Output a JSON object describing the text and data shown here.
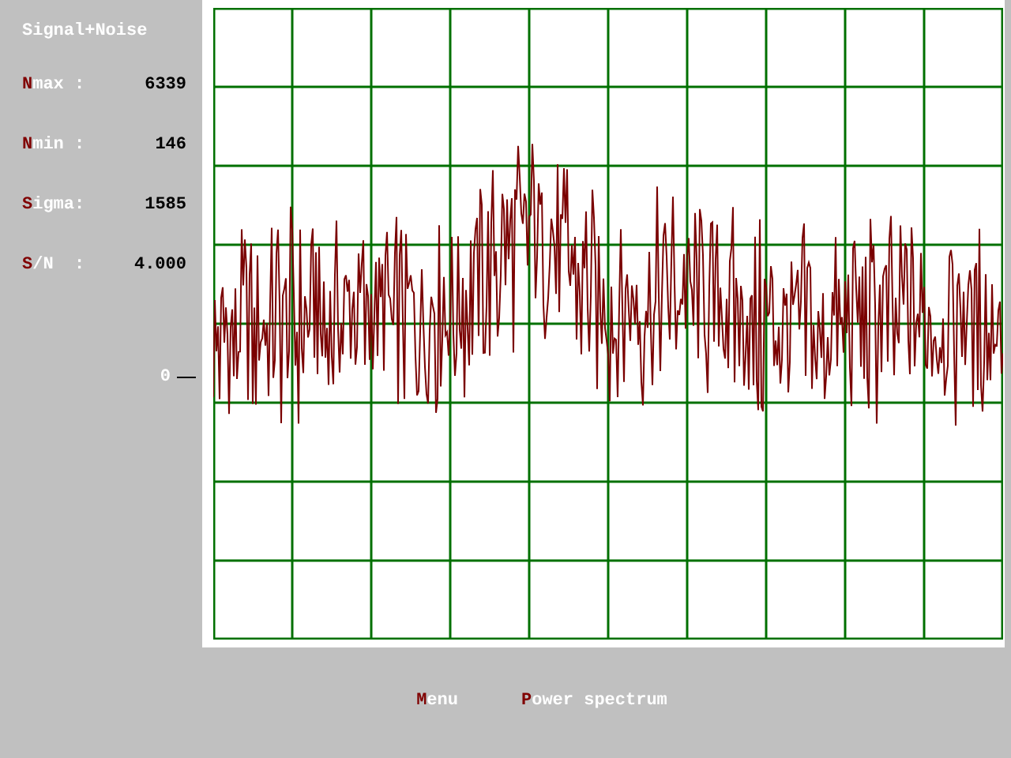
{
  "title": "Signal+Noise",
  "stats": [
    {
      "label": "Nmax :",
      "value": "6339"
    },
    {
      "label": "Nmin :",
      "value": "146"
    },
    {
      "label": "Sigma:",
      "value": "1585"
    },
    {
      "label": "S/N  :",
      "value": "4.000"
    }
  ],
  "plot": {
    "zero_label": "0"
  },
  "menu": [
    {
      "label": "Menu"
    },
    {
      "label": "Power spectrum"
    }
  ]
}
